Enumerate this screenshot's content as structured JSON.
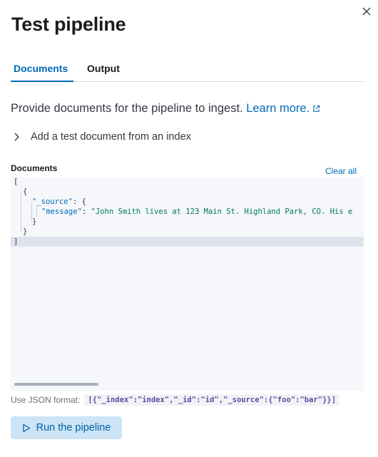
{
  "flyout": {
    "title": "Test pipeline",
    "close_icon": "close-icon"
  },
  "tabs": [
    {
      "label": "Documents",
      "selected": true
    },
    {
      "label": "Output",
      "selected": false
    }
  ],
  "intro": {
    "text": "Provide documents for the pipeline to ingest.",
    "link_label": "Learn more.",
    "link_icon": "external-link-icon"
  },
  "accordion": {
    "label": "Add a test document from an index",
    "icon": "chevron-right-icon"
  },
  "documents": {
    "label": "Documents",
    "clear_label": "Clear all",
    "code": {
      "l1": "[",
      "l2": "{",
      "l3_key": "\"_source\"",
      "l3_rest": ": {",
      "l4_key": "\"message\"",
      "l4_colon": ": ",
      "l4_value": "\"John Smith lives at 123 Main St. Highland Park, CO. His e",
      "l5": "}",
      "l6": "}",
      "l7": "]"
    }
  },
  "help": {
    "text": "Use JSON format:",
    "example": "[{\"_index\":\"index\",\"_id\":\"id\",\"_source\":{\"foo\":\"bar\"}}]"
  },
  "run_button": {
    "label": "Run the pipeline",
    "icon": "play-icon"
  },
  "colors": {
    "accent": "#006bb8",
    "button_bg": "#cce4f5",
    "editor_bg": "#f5f7fa"
  }
}
